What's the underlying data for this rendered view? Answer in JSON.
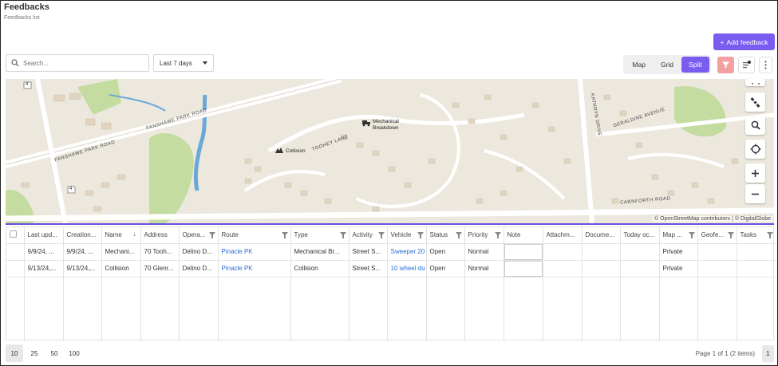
{
  "header": {
    "title": "Feedbacks",
    "subtitle": "Feedbacks list"
  },
  "toolbar": {
    "add_label": "Add feedback",
    "search_placeholder": "Search...",
    "date_range": "Last 7 days",
    "views": [
      "Map",
      "Grid",
      "Split"
    ],
    "active_view": "Split"
  },
  "map": {
    "markers": [
      {
        "label1": "Mechanical",
        "label2": "Breakdown"
      },
      {
        "label1": "Collision"
      }
    ],
    "streets": [
      "FANSHAWE PARK ROAD",
      "FANSHAWE PARK ROAD",
      "TOOHEY LANE",
      "KATHRYN DRIVE",
      "GERALDINE AVENUE",
      "CARNFORTH ROAD"
    ],
    "route_badges": [
      "4",
      "4"
    ],
    "attribution": "© OpenStreetMap contributors | © DigitalGlobe"
  },
  "table": {
    "columns": [
      "Last upd...",
      "Creation...",
      "Name",
      "Address",
      "Opera...",
      "Route",
      "Type",
      "Activity",
      "Vehicle",
      "Status",
      "Priority",
      "Note",
      "Attachm...",
      "Docume...",
      "Today oc...",
      "Map ...",
      "Geofe...",
      "Tasks"
    ],
    "rows": [
      [
        "9/9/24, ...",
        "9/9/24, ...",
        "Mechani...",
        "70 Tooh...",
        "Delino D...",
        "Pinacle PK",
        "Mechanical Br...",
        "Street S...",
        "Sweeper 20",
        "Open",
        "Normal",
        "",
        "",
        "",
        "",
        "Private",
        "",
        ""
      ],
      [
        "9/13/24,...",
        "9/13/24,...",
        "Collision",
        "70 Glenr...",
        "Delino D...",
        "Pinacle PK",
        "Collision",
        "Street S...",
        "10 wheel du",
        "Open",
        "Normal",
        "",
        "",
        "",
        "",
        "Private",
        "",
        ""
      ]
    ]
  },
  "pagination": {
    "sizes": [
      "10",
      "25",
      "50",
      "100"
    ],
    "active_size": "10",
    "info": "Page 1 of 1 (2 items)",
    "current_page": "1"
  },
  "colors": {
    "accent": "#7a5cf0",
    "link": "#2a6fd6",
    "filter_btn": "#f4a0a0"
  }
}
